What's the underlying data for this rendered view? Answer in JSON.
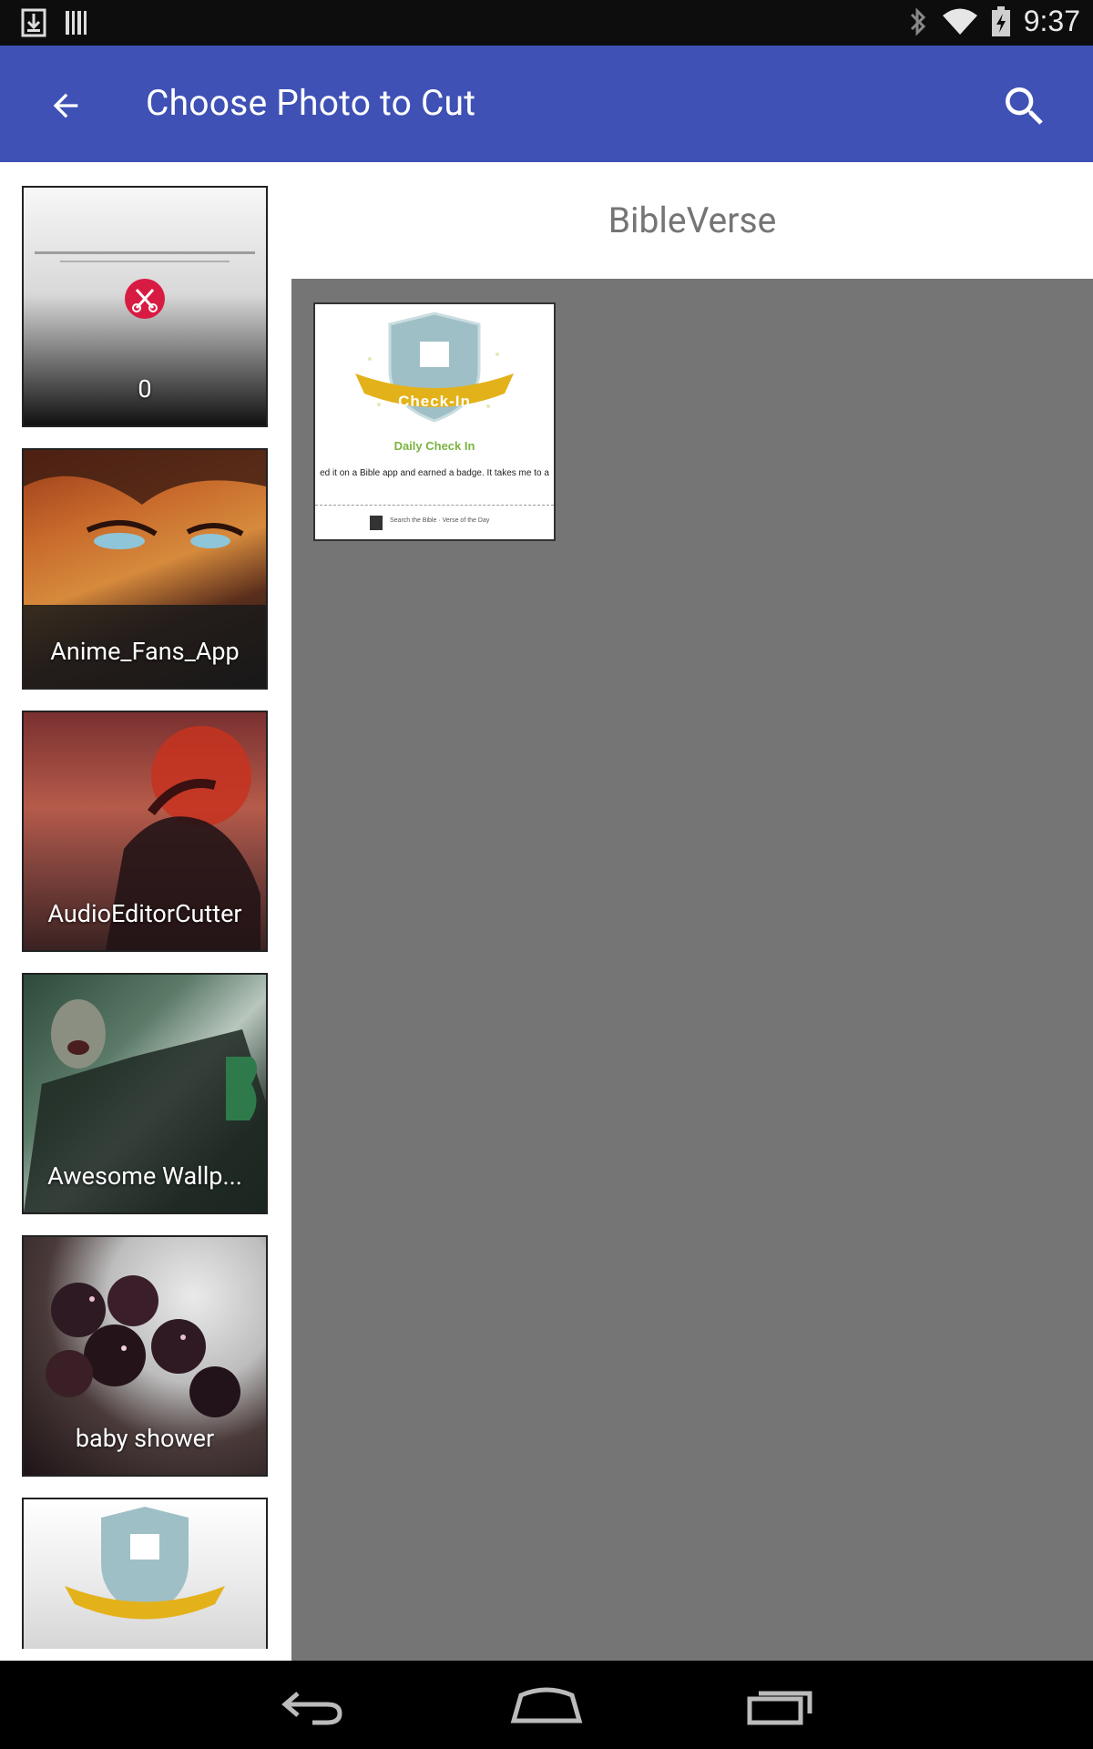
{
  "status_bar": {
    "time": "9:37",
    "icons": [
      "download-icon",
      "barcode-icon",
      "bluetooth-icon",
      "wifi-icon",
      "battery-icon"
    ]
  },
  "app_bar": {
    "title": "Choose Photo to Cut",
    "back_icon": "arrow-back-icon",
    "search_icon": "search-icon",
    "color": "#3f51b5"
  },
  "sidebar": {
    "albums": [
      {
        "label": "0"
      },
      {
        "label": "Anime_Fans_App"
      },
      {
        "label": "AudioEditorCutter"
      },
      {
        "label": "Awesome Wallp..."
      },
      {
        "label": "baby shower"
      },
      {
        "label": ""
      }
    ]
  },
  "main": {
    "folder_title": "BibleVerse",
    "photos": [
      {
        "badge_text": "Check-In",
        "caption": "Daily Check In",
        "body": "ed it on a Bible app and earned a badge. It takes me to a",
        "footer": "Search the Bible  ·  Verse of the Day"
      }
    ]
  },
  "nav_bar": {
    "icons": [
      "back-nav-icon",
      "home-nav-icon",
      "recents-nav-icon"
    ]
  }
}
